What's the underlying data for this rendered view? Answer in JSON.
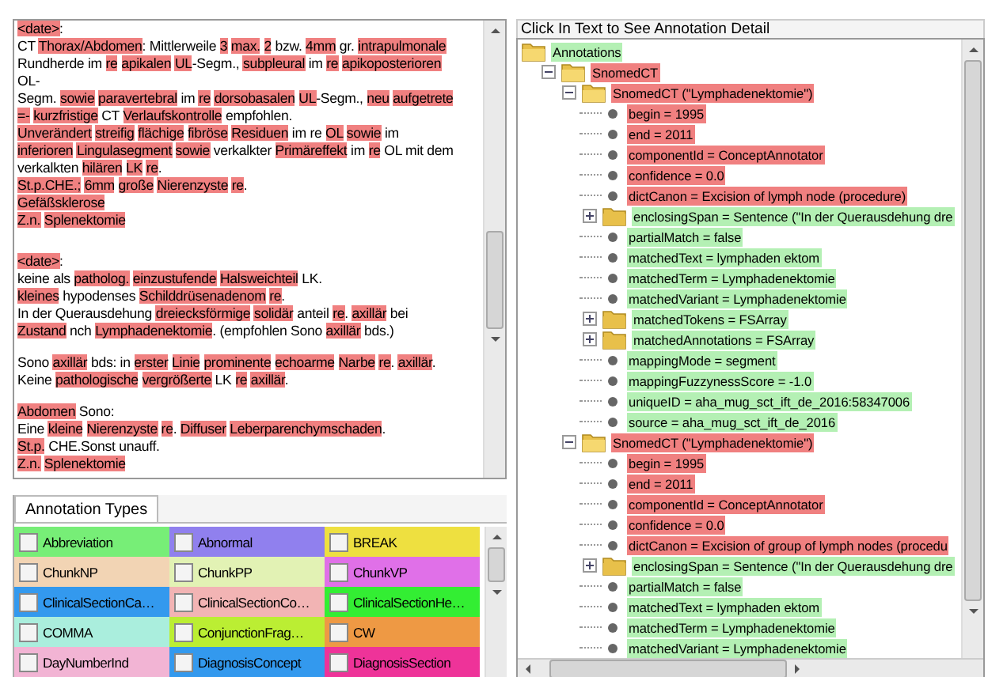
{
  "document": {
    "paragraphs": [
      {
        "lines": [
          [
            {
              "text": "<date>",
              "highlighted": true
            },
            {
              "text": ":",
              "highlighted": false
            }
          ],
          [
            {
              "text": "CT ",
              "highlighted": false
            },
            {
              "text": "Thorax/Abdomen",
              "highlighted": true
            },
            {
              "text": ": Mittlerweile ",
              "highlighted": false
            },
            {
              "text": "3",
              "highlighted": true
            },
            {
              "text": "max.",
              "highlighted": true
            },
            {
              "text": "2",
              "highlighted": true
            },
            {
              "text": " bzw. ",
              "highlighted": false
            },
            {
              "text": "4mm",
              "highlighted": true
            },
            {
              "text": " gr. ",
              "highlighted": false
            },
            {
              "text": "intrapulmonale",
              "highlighted": true
            }
          ],
          [
            {
              "text": "Rundherde im ",
              "highlighted": false
            },
            {
              "text": "re",
              "highlighted": true
            },
            {
              "text": "apikalen",
              "highlighted": true
            },
            {
              "text": "UL",
              "highlighted": true
            },
            {
              "text": "-Segm., ",
              "highlighted": false
            },
            {
              "text": "subpleural",
              "highlighted": true
            },
            {
              "text": " im ",
              "highlighted": false
            },
            {
              "text": "re",
              "highlighted": true
            },
            {
              "text": "apikoposterioren",
              "highlighted": true
            }
          ],
          [
            {
              "text": "OL-",
              "highlighted": false
            }
          ],
          [
            {
              "text": "Segm. ",
              "highlighted": false
            },
            {
              "text": "sowie",
              "highlighted": true
            },
            {
              "text": "paravertebral",
              "highlighted": true
            },
            {
              "text": " im ",
              "highlighted": false
            },
            {
              "text": "re",
              "highlighted": true
            },
            {
              "text": "dorsobasalen",
              "highlighted": true
            },
            {
              "text": "UL",
              "highlighted": true
            },
            {
              "text": "-Segm., ",
              "highlighted": false
            },
            {
              "text": "neu",
              "highlighted": true
            },
            {
              "text": "aufgetrete",
              "highlighted": true
            }
          ],
          [
            {
              "text": "=-",
              "highlighted": true
            },
            {
              "text": "kurzfristige",
              "highlighted": true
            },
            {
              "text": " CT ",
              "highlighted": false
            },
            {
              "text": "Verlaufskontrolle",
              "highlighted": true
            },
            {
              "text": " empfohlen.",
              "highlighted": false
            }
          ],
          [
            {
              "text": "Unverändert",
              "highlighted": true
            },
            {
              "text": "streifig",
              "highlighted": true
            },
            {
              "text": "flächige",
              "highlighted": true
            },
            {
              "text": "fibröse",
              "highlighted": true
            },
            {
              "text": "Residuen",
              "highlighted": true
            },
            {
              "text": " im re ",
              "highlighted": false
            },
            {
              "text": "OL",
              "highlighted": true
            },
            {
              "text": "sowie",
              "highlighted": true
            },
            {
              "text": " im",
              "highlighted": false
            }
          ],
          [
            {
              "text": "inferioren",
              "highlighted": true
            },
            {
              "text": "Lingulasegment",
              "highlighted": true
            },
            {
              "text": "sowie",
              "highlighted": true
            },
            {
              "text": " verkalkter ",
              "highlighted": false
            },
            {
              "text": "Primäreffekt",
              "highlighted": true
            },
            {
              "text": " im ",
              "highlighted": false
            },
            {
              "text": "re",
              "highlighted": true
            },
            {
              "text": " OL mit dem",
              "highlighted": false
            }
          ],
          [
            {
              "text": "verkalkten ",
              "highlighted": false
            },
            {
              "text": "hilären",
              "highlighted": true
            },
            {
              "text": "LK",
              "highlighted": true
            },
            {
              "text": "re",
              "highlighted": true
            },
            {
              "text": ".",
              "highlighted": false
            }
          ],
          [
            {
              "text": "St.p.CHE.;",
              "highlighted": true
            },
            {
              "text": "6mm",
              "highlighted": true
            },
            {
              "text": "große",
              "highlighted": true
            },
            {
              "text": "Nierenzyste",
              "highlighted": true
            },
            {
              "text": "re",
              "highlighted": true
            },
            {
              "text": ".",
              "highlighted": false
            }
          ],
          [
            {
              "text": "Gefäßsklerose",
              "highlighted": true
            }
          ],
          [
            {
              "text": "Z.n.",
              "highlighted": true
            },
            {
              "text": "Splenektomie",
              "highlighted": true
            }
          ]
        ]
      },
      {
        "lines": [
          [
            {
              "text": "<date>",
              "highlighted": true
            },
            {
              "text": ":",
              "highlighted": false
            }
          ],
          [
            {
              "text": "keine als ",
              "highlighted": false
            },
            {
              "text": "patholog.",
              "highlighted": true
            },
            {
              "text": "einzustufende",
              "highlighted": true
            },
            {
              "text": "Halsweichteil",
              "highlighted": true
            },
            {
              "text": " LK.",
              "highlighted": false
            }
          ],
          [
            {
              "text": "kleines",
              "highlighted": true
            },
            {
              "text": " hypodenses ",
              "highlighted": false
            },
            {
              "text": "Schilddrüsenadenom",
              "highlighted": true
            },
            {
              "text": "re",
              "highlighted": true
            },
            {
              "text": ".",
              "highlighted": false
            }
          ],
          [
            {
              "text": "In der Querausdehung ",
              "highlighted": false
            },
            {
              "text": "dreiecksförmige",
              "highlighted": true
            },
            {
              "text": "solidär",
              "highlighted": true
            },
            {
              "text": " anteil ",
              "highlighted": false
            },
            {
              "text": "re",
              "highlighted": true
            },
            {
              "text": ". ",
              "highlighted": false
            },
            {
              "text": "axillär",
              "highlighted": true
            },
            {
              "text": " bei",
              "highlighted": false
            }
          ],
          [
            {
              "text": "Zustand",
              "highlighted": true
            },
            {
              "text": " nch ",
              "highlighted": false
            },
            {
              "text": "Lymphadenektomie",
              "highlighted": true
            },
            {
              "text": ". (empfohlen Sono ",
              "highlighted": false
            },
            {
              "text": "axillär",
              "highlighted": true
            },
            {
              "text": " bds.)",
              "highlighted": false
            }
          ]
        ]
      },
      {
        "lines": [
          [
            {
              "text": "Sono ",
              "highlighted": false
            },
            {
              "text": "axillär",
              "highlighted": true
            },
            {
              "text": " bds: in ",
              "highlighted": false
            },
            {
              "text": "erster",
              "highlighted": true
            },
            {
              "text": "Linie",
              "highlighted": true
            },
            {
              "text": "prominente",
              "highlighted": true
            },
            {
              "text": "echoarme",
              "highlighted": true
            },
            {
              "text": "Narbe",
              "highlighted": true
            },
            {
              "text": "re",
              "highlighted": true
            },
            {
              "text": ". ",
              "highlighted": false
            },
            {
              "text": "axillär",
              "highlighted": true
            },
            {
              "text": ".",
              "highlighted": false
            }
          ],
          [
            {
              "text": "Keine ",
              "highlighted": false
            },
            {
              "text": "pathologische",
              "highlighted": true
            },
            {
              "text": "vergrößerte",
              "highlighted": true
            },
            {
              "text": " LK ",
              "highlighted": false
            },
            {
              "text": "re",
              "highlighted": true
            },
            {
              "text": "axillär",
              "highlighted": true
            },
            {
              "text": ".",
              "highlighted": false
            }
          ]
        ]
      },
      {
        "lines": [
          [
            {
              "text": "Abdomen",
              "highlighted": true
            },
            {
              "text": " Sono:",
              "highlighted": false
            }
          ],
          [
            {
              "text": "Eine ",
              "highlighted": false
            },
            {
              "text": "kleine",
              "highlighted": true
            },
            {
              "text": "Nierenzyste",
              "highlighted": true
            },
            {
              "text": "re",
              "highlighted": true
            },
            {
              "text": ". ",
              "highlighted": false
            },
            {
              "text": "Diffuser",
              "highlighted": true
            },
            {
              "text": "Leberparenchymschaden",
              "highlighted": true
            },
            {
              "text": ".",
              "highlighted": false
            }
          ],
          [
            {
              "text": "St.p.",
              "highlighted": true
            },
            {
              "text": " CHE.Sonst unauff.",
              "highlighted": false
            }
          ],
          [
            {
              "text": "Z.n.",
              "highlighted": true
            },
            {
              "text": "Splenektomie",
              "highlighted": true
            }
          ]
        ]
      }
    ]
  },
  "annotation_types": {
    "tab": {
      "label": "Annotation Types",
      "selected": true
    },
    "items": [
      {
        "label": "Abbreviation",
        "color": "#77ee77",
        "checked": false
      },
      {
        "label": "Abnormal",
        "color": "#9080ee",
        "checked": false
      },
      {
        "label": "BREAK",
        "color": "#eee040",
        "checked": false
      },
      {
        "label": "ChunkNP",
        "color": "#f2d4b4",
        "checked": false
      },
      {
        "label": "ChunkPP",
        "color": "#e2f2b4",
        "checked": false
      },
      {
        "label": "ChunkVP",
        "color": "#e070e8",
        "checked": false
      },
      {
        "label": "ClinicalSectionCa…",
        "color": "#3399ee",
        "checked": false
      },
      {
        "label": "ClinicalSectionCo…",
        "color": "#f2b4b4",
        "checked": false
      },
      {
        "label": "ClinicalSectionHe…",
        "color": "#33ee33",
        "checked": false
      },
      {
        "label": "COMMA",
        "color": "#aaeedd",
        "checked": false
      },
      {
        "label": "ConjunctionFrag…",
        "color": "#bbee33",
        "checked": false
      },
      {
        "label": "CW",
        "color": "#ee9944",
        "checked": false
      },
      {
        "label": "DayNumberInd",
        "color": "#f2b4d4",
        "checked": false
      },
      {
        "label": "DiagnosisConcept",
        "color": "#3399ee",
        "checked": false
      },
      {
        "label": "DiagnosisSection",
        "color": "#ee3399",
        "checked": false
      }
    ]
  },
  "detail": {
    "header": "Click In Text to See Annotation Detail",
    "tree": [
      {
        "label": "Annotations",
        "kind": "folder",
        "color": "#b4f0b4",
        "expanded": true,
        "children": [
          {
            "label": "SnomedCT",
            "kind": "folder",
            "color": "#f08080",
            "expanded": true,
            "children": [
              {
                "label": "SnomedCT (\"Lymphadenektomie\")",
                "kind": "folder",
                "color": "#f08080",
                "expanded": true,
                "children": [
                  {
                    "label": "begin = 1995",
                    "kind": "leaf",
                    "color": "#f08080"
                  },
                  {
                    "label": "end = 2011",
                    "kind": "leaf",
                    "color": "#f08080"
                  },
                  {
                    "label": "componentId = ConceptAnnotator",
                    "kind": "leaf",
                    "color": "#f08080"
                  },
                  {
                    "label": "confidence = 0.0",
                    "kind": "leaf",
                    "color": "#f08080"
                  },
                  {
                    "label": "dictCanon = Excision of lymph node (procedure)",
                    "kind": "leaf",
                    "color": "#f08080"
                  },
                  {
                    "label": "enclosingSpan = Sentence (\"In der Querausdehung dre",
                    "kind": "folder",
                    "color": "#b4f0b4",
                    "expanded": false
                  },
                  {
                    "label": "partialMatch = false",
                    "kind": "leaf",
                    "color": "#b4f0b4"
                  },
                  {
                    "label": "matchedText = lymphaden ektom",
                    "kind": "leaf",
                    "color": "#b4f0b4"
                  },
                  {
                    "label": "matchedTerm = Lymphadenektomie",
                    "kind": "leaf",
                    "color": "#b4f0b4"
                  },
                  {
                    "label": "matchedVariant = Lymphadenektomie",
                    "kind": "leaf",
                    "color": "#b4f0b4"
                  },
                  {
                    "label": "matchedTokens = FSArray",
                    "kind": "folder",
                    "color": "#b4f0b4",
                    "expanded": false
                  },
                  {
                    "label": "matchedAnnotations = FSArray",
                    "kind": "folder",
                    "color": "#b4f0b4",
                    "expanded": false
                  },
                  {
                    "label": "mappingMode = segment",
                    "kind": "leaf",
                    "color": "#b4f0b4"
                  },
                  {
                    "label": "mappingFuzzynessScore = -1.0",
                    "kind": "leaf",
                    "color": "#b4f0b4"
                  },
                  {
                    "label": "uniqueID = aha_mug_sct_ift_de_2016:58347006",
                    "kind": "leaf",
                    "color": "#b4f0b4"
                  },
                  {
                    "label": "source = aha_mug_sct_ift_de_2016",
                    "kind": "leaf",
                    "color": "#b4f0b4"
                  }
                ]
              },
              {
                "label": "SnomedCT (\"Lymphadenektomie\")",
                "kind": "folder",
                "color": "#f08080",
                "expanded": true,
                "children": [
                  {
                    "label": "begin = 1995",
                    "kind": "leaf",
                    "color": "#f08080"
                  },
                  {
                    "label": "end = 2011",
                    "kind": "leaf",
                    "color": "#f08080"
                  },
                  {
                    "label": "componentId = ConceptAnnotator",
                    "kind": "leaf",
                    "color": "#f08080"
                  },
                  {
                    "label": "confidence = 0.0",
                    "kind": "leaf",
                    "color": "#f08080"
                  },
                  {
                    "label": "dictCanon = Excision of group of lymph nodes (procedu",
                    "kind": "leaf",
                    "color": "#f08080"
                  },
                  {
                    "label": "enclosingSpan = Sentence (\"In der Querausdehung dre",
                    "kind": "folder",
                    "color": "#b4f0b4",
                    "expanded": false
                  },
                  {
                    "label": "partialMatch = false",
                    "kind": "leaf",
                    "color": "#b4f0b4"
                  },
                  {
                    "label": "matchedText = lymphaden ektom",
                    "kind": "leaf",
                    "color": "#b4f0b4"
                  },
                  {
                    "label": "matchedTerm = Lymphadenektomie",
                    "kind": "leaf",
                    "color": "#b4f0b4"
                  },
                  {
                    "label": "matchedVariant = Lymphadenektomie",
                    "kind": "leaf",
                    "color": "#b4f0b4"
                  }
                ]
              }
            ]
          }
        ]
      }
    ]
  }
}
